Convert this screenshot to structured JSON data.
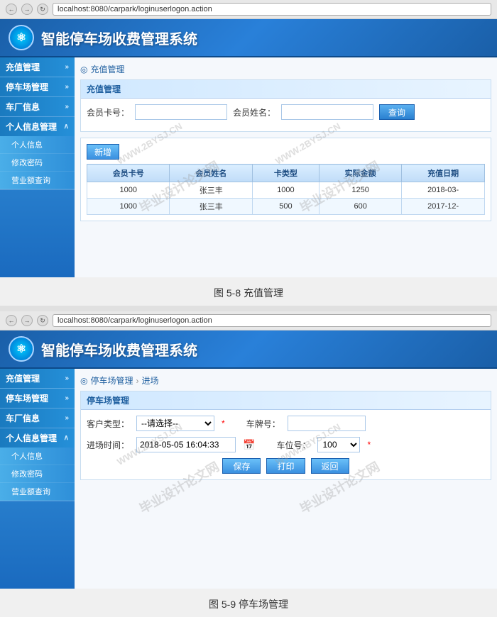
{
  "screenshot1": {
    "browser": {
      "url": "localhost:8080/carpark/loginuserlogon.action"
    },
    "header": {
      "title": "智能停车场收费管理系统",
      "logo_text": "☯"
    },
    "sidebar": {
      "sections": [
        {
          "label": "充值管理",
          "expanded": false
        },
        {
          "label": "停车场管理",
          "expanded": false
        },
        {
          "label": "车厂信息",
          "expanded": false
        },
        {
          "label": "个人信息管理",
          "expanded": true,
          "items": [
            "个人信息",
            "修改密码",
            "营业额查询"
          ]
        }
      ]
    },
    "breadcrumb": "充值管理",
    "breadcrumb_icon": "◎",
    "panel_search": {
      "title": "充值管理",
      "fields": [
        {
          "label": "会员卡号：",
          "placeholder": "",
          "value": ""
        },
        {
          "label": "会员姓名：",
          "placeholder": "",
          "value": ""
        }
      ],
      "search_btn": "查询"
    },
    "panel_table": {
      "new_btn": "新增",
      "columns": [
        "会员卡号",
        "会员姓名",
        "卡类型",
        "实际金额",
        "充值日期"
      ],
      "rows": [
        {
          "card_no": "1000",
          "name": "张三丰",
          "card_type": "1000",
          "amount": "1250",
          "date": "2018-03-"
        },
        {
          "card_no": "1000",
          "name": "张三丰",
          "card_type": "500",
          "amount": "600",
          "date": "2017-12-"
        }
      ]
    },
    "watermarks": [
      "WWW.2BYSJ.CN",
      "毕业设计论文网",
      "WWW.2BYSJ.CN"
    ]
  },
  "caption1": "图 5-8 充值管理",
  "screenshot2": {
    "browser": {
      "url": "localhost:8080/carpark/loginuserlogon.action"
    },
    "header": {
      "title": "智能停车场收费管理系统",
      "logo_text": "☯"
    },
    "sidebar": {
      "sections": [
        {
          "label": "充值管理",
          "expanded": false
        },
        {
          "label": "停车场管理",
          "expanded": false
        },
        {
          "label": "车厂信息",
          "expanded": false
        },
        {
          "label": "个人信息管理",
          "expanded": true,
          "items": [
            "个人信息",
            "修改密码",
            "营业额查询"
          ]
        }
      ]
    },
    "breadcrumb_parts": [
      "停车场管理",
      "进场"
    ],
    "breadcrumb_icon": "◎",
    "panel_form": {
      "title": "停车场管理",
      "fields": [
        {
          "label": "客户类型：",
          "type": "select",
          "value": "--请选择--",
          "required": true
        },
        {
          "label": "车牌号：",
          "type": "input",
          "value": "",
          "required": false
        },
        {
          "label": "进场时间：",
          "type": "datetime",
          "value": "2018-05-05 16:04:33",
          "required": false
        },
        {
          "label": "车位号：",
          "type": "select",
          "value": "100",
          "required": true
        }
      ],
      "buttons": [
        "保存",
        "打印",
        "返回"
      ]
    },
    "watermarks": [
      "WWW.2BYSJ.CN",
      "毕业设计论文网",
      "WWW.2BYSJ.CN"
    ]
  },
  "caption2": "图 5-9 停车场管理"
}
